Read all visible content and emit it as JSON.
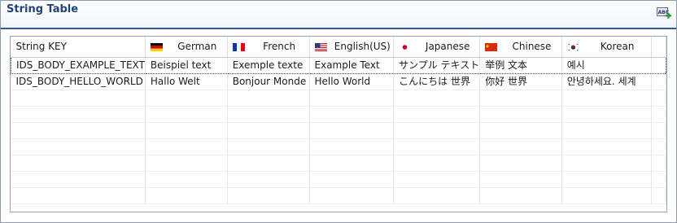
{
  "panel": {
    "title": "String Table",
    "action_icon": "spellcheck-add-icon"
  },
  "table": {
    "headers": [
      {
        "label": "String KEY",
        "flag": null
      },
      {
        "label": "German",
        "flag": "flag-germany-icon"
      },
      {
        "label": "French",
        "flag": "flag-france-icon"
      },
      {
        "label": "English(US)",
        "flag": "flag-usa-icon"
      },
      {
        "label": "Japanese",
        "flag": "flag-japan-icon"
      },
      {
        "label": "Chinese",
        "flag": "flag-china-icon"
      },
      {
        "label": "Korean",
        "flag": "flag-korea-icon"
      },
      {
        "label": "",
        "flag": null
      }
    ],
    "rows": [
      [
        "IDS_BODY_EXAMPLE_TEXT",
        "Beispiel text",
        "Exemple texte",
        "Example Text",
        "サンプル テキスト",
        "举例 文本",
        "예시",
        ""
      ],
      [
        "IDS_BODY_HELLO_WORLD",
        "Hallo Welt",
        "Bonjour Monde",
        "Hello World",
        "こんにちは 世界",
        "你好 世界",
        "안녕하세요. 세계",
        ""
      ]
    ],
    "selected_row": 0
  }
}
